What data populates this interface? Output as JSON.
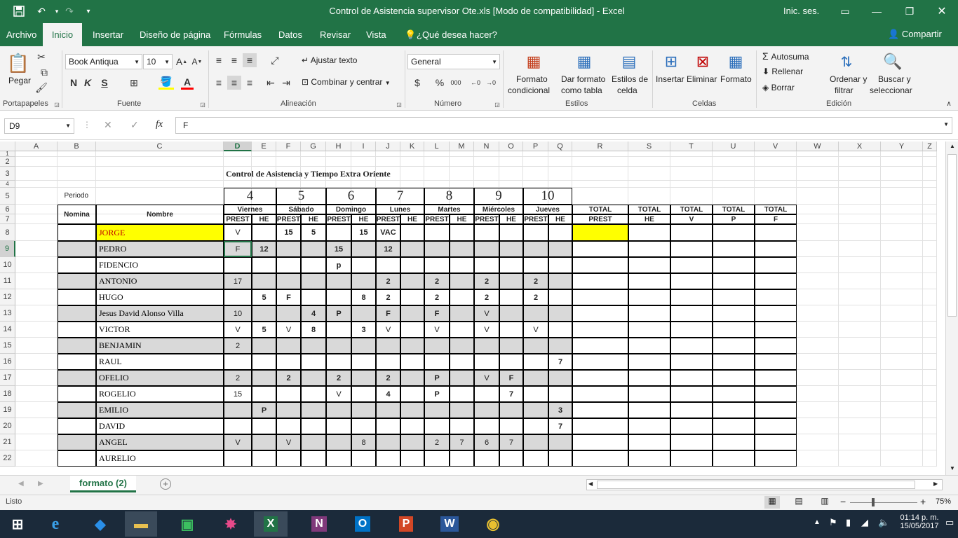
{
  "window": {
    "title": "Control de Asistencia supervisor Ote.xls  [Modo de compatibilidad]  -  Excel",
    "sign_in": "Inic. ses."
  },
  "tabs": [
    "Archivo",
    "Inicio",
    "Insertar",
    "Diseño de página",
    "Fórmulas",
    "Datos",
    "Revisar",
    "Vista"
  ],
  "tell_me": "¿Qué desea hacer?",
  "share": "Compartir",
  "ribbon": {
    "paste": "Pegar",
    "font_name": "Book Antiqua",
    "font_size": "10",
    "wrap_text": "Ajustar texto",
    "merge_center": "Combinar y centrar",
    "number_format": "General",
    "cond_format_1": "Formato",
    "cond_format_2": "condicional",
    "format_table_1": "Dar formato",
    "format_table_2": "como tabla",
    "cell_styles_1": "Estilos de",
    "cell_styles_2": "celda",
    "insert": "Insertar",
    "delete": "Eliminar",
    "format": "Formato",
    "autosum": "Autosuma",
    "fill": "Rellenar",
    "clear": "Borrar",
    "sort_1": "Ordenar y",
    "sort_2": "filtrar",
    "find_1": "Buscar y",
    "find_2": "seleccionar",
    "groups": [
      "Portapapeles",
      "Fuente",
      "Alineación",
      "Número",
      "Estilos",
      "Celdas",
      "Edición"
    ],
    "bold": "N",
    "italic": "K",
    "underline": "S",
    "currency": "$",
    "percent": "%",
    "thousands": "000"
  },
  "formula_bar": {
    "cell_ref": "D9",
    "fx": "fx",
    "value": "F"
  },
  "columns": [
    "A",
    "B",
    "C",
    "D",
    "E",
    "F",
    "G",
    "H",
    "I",
    "J",
    "K",
    "L",
    "M",
    "N",
    "O",
    "P",
    "Q",
    "R",
    "S",
    "T",
    "U",
    "V",
    "W",
    "X",
    "Y",
    "Z"
  ],
  "rows": [
    "1",
    "2",
    "3",
    "4",
    "5",
    "6",
    "7",
    "8",
    "9",
    "10",
    "11",
    "12",
    "13",
    "14",
    "15",
    "16",
    "17",
    "18",
    "19",
    "20",
    "21",
    "22"
  ],
  "sheet": {
    "title": "Control de Asistencia y Tiempo Extra Oriente",
    "periodo": "Periodo",
    "nomina": "Nomina",
    "nombre": "Nombre",
    "dates": [
      "4",
      "5",
      "6",
      "7",
      "8",
      "9",
      "10"
    ],
    "days": [
      "Viernes",
      "Sábado",
      "Domingo",
      "Lunes",
      "Martes",
      "Miércoles",
      "Jueves"
    ],
    "prest": "PREST",
    "he": "HE",
    "total": "TOTAL",
    "total_subs": [
      "PREST",
      "HE",
      "V",
      "P",
      "F"
    ],
    "employees": [
      {
        "name": "JORGE",
        "vals": [
          "V",
          "",
          "15",
          "5",
          "",
          "15",
          "VAC",
          "",
          "",
          "",
          "",
          "",
          "",
          ""
        ]
      },
      {
        "name": "PEDRO",
        "vals": [
          "F",
          "12",
          "",
          "",
          "15",
          "",
          "12",
          "",
          "",
          "",
          "",
          "",
          "",
          ""
        ]
      },
      {
        "name": "FIDENCIO",
        "vals": [
          "",
          "",
          "",
          "",
          "p",
          "",
          "",
          "",
          "",
          "",
          "",
          "",
          "",
          ""
        ]
      },
      {
        "name": "ANTONIO",
        "vals": [
          "17",
          "",
          "",
          "",
          "",
          "",
          "2",
          "",
          "2",
          "",
          "2",
          "",
          "2",
          ""
        ]
      },
      {
        "name": "HUGO",
        "vals": [
          "",
          "5",
          "F",
          "",
          "",
          "8",
          "2",
          "",
          "2",
          "",
          "2",
          "",
          "2",
          ""
        ]
      },
      {
        "name": "Jesus David Alonso Villa",
        "vals": [
          "10",
          "",
          "",
          "4",
          "P",
          "",
          "F",
          "",
          "F",
          "",
          "V",
          "",
          "",
          ""
        ]
      },
      {
        "name": "VICTOR",
        "vals": [
          "V",
          "5",
          "V",
          "8",
          "",
          "3",
          "V",
          "",
          "V",
          "",
          "V",
          "",
          "V",
          ""
        ]
      },
      {
        "name": "BENJAMIN",
        "vals": [
          "2",
          "",
          "",
          "",
          "",
          "",
          "",
          "",
          "",
          "",
          "",
          "",
          "",
          ""
        ]
      },
      {
        "name": "RAUL",
        "vals": [
          "",
          "",
          "",
          "",
          "",
          "",
          "",
          "",
          "",
          "",
          "",
          "",
          "",
          "7"
        ]
      },
      {
        "name": "OFELIO",
        "vals": [
          "2",
          "",
          "2",
          "",
          "2",
          "",
          "2",
          "",
          "P",
          "",
          "V",
          "F",
          "",
          ""
        ]
      },
      {
        "name": "ROGELIO",
        "vals": [
          "15",
          "",
          "",
          "",
          "V",
          "",
          "4",
          "",
          "P",
          "",
          "",
          "7",
          "",
          ""
        ]
      },
      {
        "name": "EMILIO",
        "vals": [
          "",
          "P",
          "",
          "",
          "",
          "",
          "",
          "",
          "",
          "",
          "",
          "",
          "",
          "3"
        ]
      },
      {
        "name": "DAVID",
        "vals": [
          "",
          "",
          "",
          "",
          "",
          "",
          "",
          "",
          "",
          "",
          "",
          "",
          "",
          "7"
        ]
      },
      {
        "name": "ANGEL",
        "vals": [
          "V",
          "",
          "V",
          "",
          "",
          "8",
          "",
          "",
          "2",
          "7",
          "6",
          "7",
          "",
          ""
        ]
      },
      {
        "name": "AURELIO",
        "vals": [
          "",
          "",
          "",
          "",
          "",
          "",
          "",
          "",
          "",
          "",
          "",
          "",
          "",
          ""
        ]
      }
    ]
  },
  "sheet_tab": "formato (2)",
  "status": {
    "ready": "Listo",
    "zoom": "75%"
  },
  "clock": {
    "time": "01:14 p. m.",
    "date": "15/05/2017"
  },
  "colors": {
    "excel_green": "#217346",
    "highlight_yellow": "#ffff00",
    "name_red": "#c00000",
    "stripe_gray": "#d9d9d9"
  }
}
